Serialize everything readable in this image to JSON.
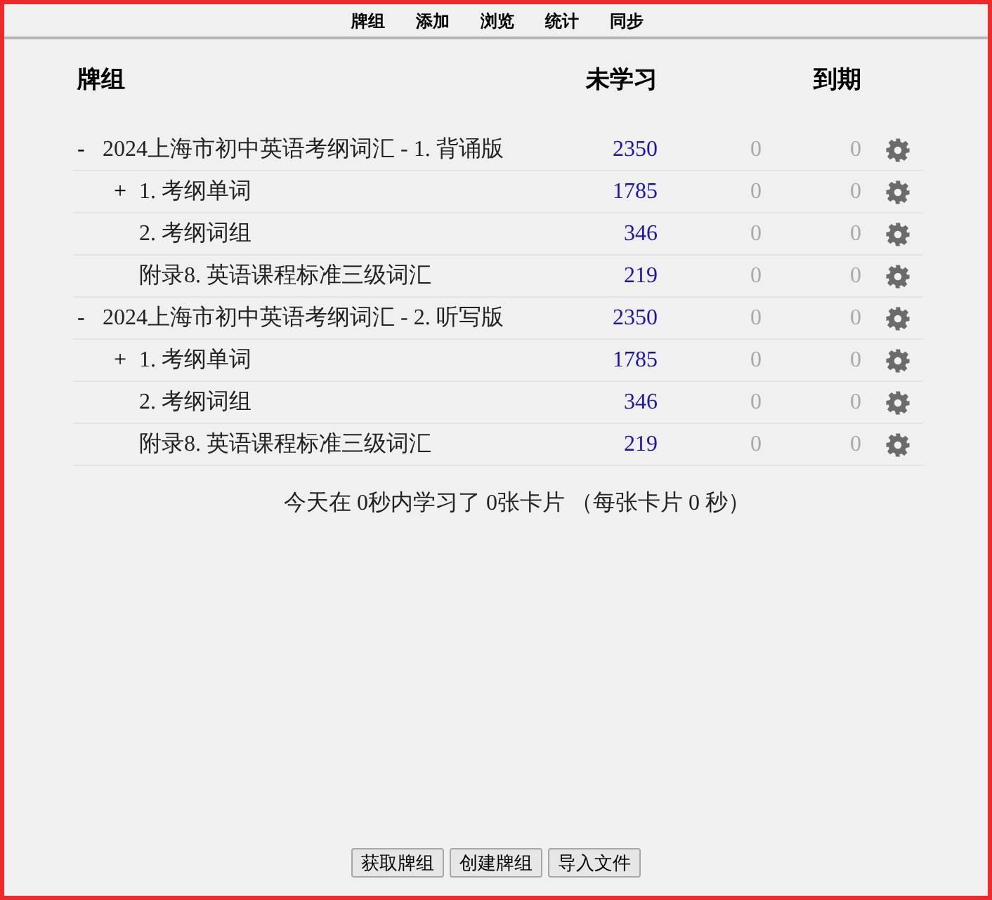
{
  "toolbar": [
    "牌组",
    "添加",
    "浏览",
    "统计",
    "同步"
  ],
  "columns": [
    "牌组",
    "未学习",
    "到期"
  ],
  "decks": [
    {
      "toggle": "-",
      "name": "2024上海市初中英语考纲词汇 - 1. 背诵版",
      "new": "2350",
      "learn": "0",
      "due": "0",
      "children": [
        {
          "toggle": "+",
          "name": "1. 考纲单词",
          "new": "1785",
          "learn": "0",
          "due": "0"
        },
        {
          "name": "2. 考纲词组",
          "new": "346",
          "learn": "0",
          "due": "0"
        },
        {
          "name": "附录8. 英语课程标准三级词汇",
          "new": "219",
          "learn": "0",
          "due": "0"
        }
      ]
    },
    {
      "toggle": "-",
      "name": "2024上海市初中英语考纲词汇 - 2. 听写版",
      "new": "2350",
      "learn": "0",
      "due": "0",
      "children": [
        {
          "toggle": "+",
          "name": "1. 考纲单词",
          "new": "1785",
          "learn": "0",
          "due": "0"
        },
        {
          "name": "2. 考纲词组",
          "new": "346",
          "learn": "0",
          "due": "0"
        },
        {
          "name": "附录8. 英语课程标准三级词汇",
          "new": "219",
          "learn": "0",
          "due": "0"
        }
      ]
    }
  ],
  "summary": "今天在 0秒内学习了 0张卡片 （每张卡片 0 秒）",
  "buttons": [
    "获取牌组",
    "创建牌组",
    "导入文件"
  ]
}
